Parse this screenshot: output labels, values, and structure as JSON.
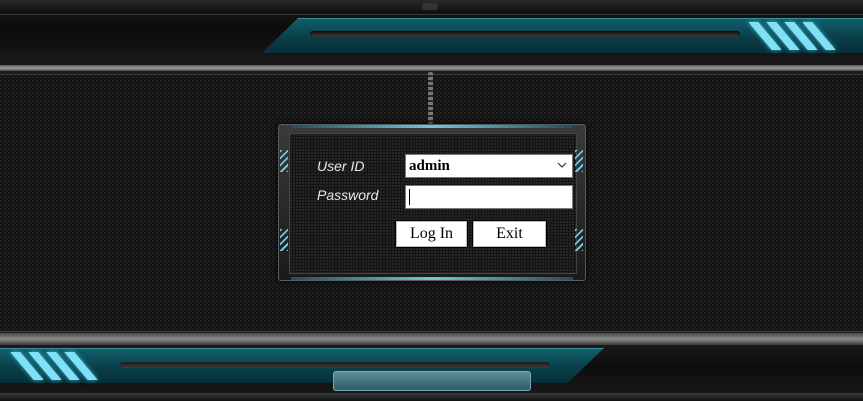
{
  "login": {
    "userid_label": "User ID",
    "password_label": "Password",
    "userid_value": "admin",
    "password_value": "",
    "login_button": "Log In",
    "exit_button": "Exit"
  },
  "icons": {
    "dropdown": "chevron-down-icon"
  },
  "colors": {
    "accent_teal": "#0a3f48",
    "accent_stripe": "#7fe0f6",
    "background": "#121212"
  }
}
